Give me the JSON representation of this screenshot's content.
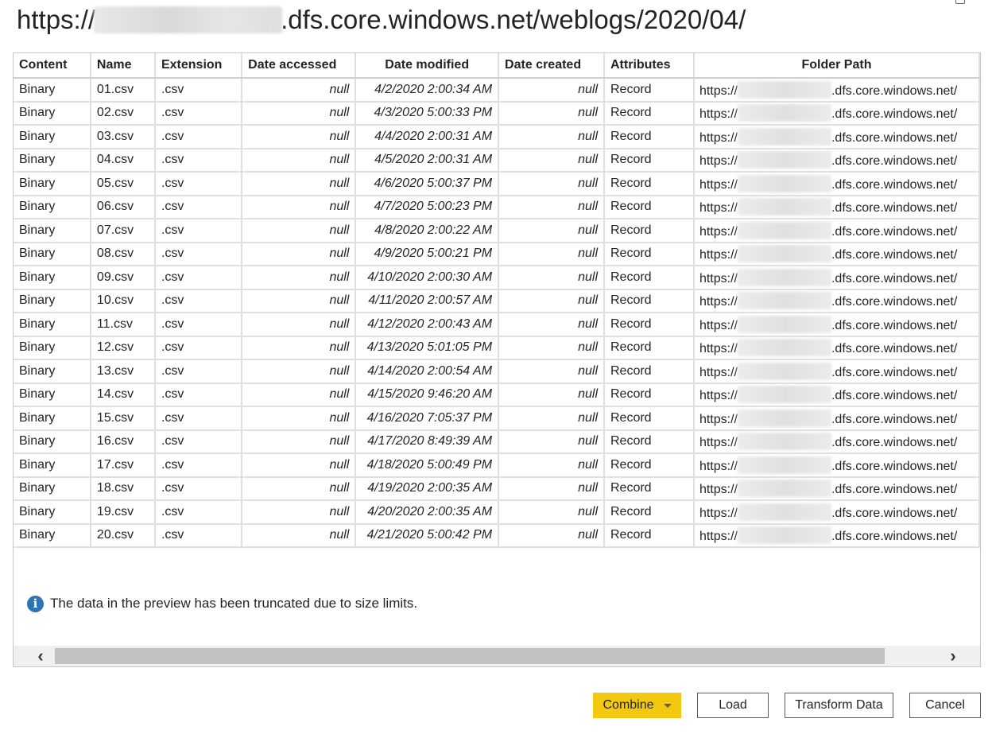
{
  "window": {
    "title_prefix": "https://",
    "title_suffix": ".dfs.core.windows.net/weblogs/2020/04/"
  },
  "table": {
    "columns": [
      "Content",
      "Name",
      "Extension",
      "Date accessed",
      "Date modified",
      "Date created",
      "Attributes",
      "Folder Path"
    ],
    "rows": [
      [
        "Binary",
        "01.csv",
        ".csv",
        "null",
        "4/2/2020 2:00:34 AM",
        "null",
        "Record",
        "https://",
        ".dfs.core.windows.net/"
      ],
      [
        "Binary",
        "02.csv",
        ".csv",
        "null",
        "4/3/2020 5:00:33 PM",
        "null",
        "Record",
        "https://",
        ".dfs.core.windows.net/"
      ],
      [
        "Binary",
        "03.csv",
        ".csv",
        "null",
        "4/4/2020 2:00:31 AM",
        "null",
        "Record",
        "https://",
        ".dfs.core.windows.net/"
      ],
      [
        "Binary",
        "04.csv",
        ".csv",
        "null",
        "4/5/2020 2:00:31 AM",
        "null",
        "Record",
        "https://",
        ".dfs.core.windows.net/"
      ],
      [
        "Binary",
        "05.csv",
        ".csv",
        "null",
        "4/6/2020 5:00:37 PM",
        "null",
        "Record",
        "https://",
        ".dfs.core.windows.net/"
      ],
      [
        "Binary",
        "06.csv",
        ".csv",
        "null",
        "4/7/2020 5:00:23 PM",
        "null",
        "Record",
        "https://",
        ".dfs.core.windows.net/"
      ],
      [
        "Binary",
        "07.csv",
        ".csv",
        "null",
        "4/8/2020 2:00:22 AM",
        "null",
        "Record",
        "https://",
        ".dfs.core.windows.net/"
      ],
      [
        "Binary",
        "08.csv",
        ".csv",
        "null",
        "4/9/2020 5:00:21 PM",
        "null",
        "Record",
        "https://",
        ".dfs.core.windows.net/"
      ],
      [
        "Binary",
        "09.csv",
        ".csv",
        "null",
        "4/10/2020 2:00:30 AM",
        "null",
        "Record",
        "https://",
        ".dfs.core.windows.net/"
      ],
      [
        "Binary",
        "10.csv",
        ".csv",
        "null",
        "4/11/2020 2:00:57 AM",
        "null",
        "Record",
        "https://",
        ".dfs.core.windows.net/"
      ],
      [
        "Binary",
        "11.csv",
        ".csv",
        "null",
        "4/12/2020 2:00:43 AM",
        "null",
        "Record",
        "https://",
        ".dfs.core.windows.net/"
      ],
      [
        "Binary",
        "12.csv",
        ".csv",
        "null",
        "4/13/2020 5:01:05 PM",
        "null",
        "Record",
        "https://",
        ".dfs.core.windows.net/"
      ],
      [
        "Binary",
        "13.csv",
        ".csv",
        "null",
        "4/14/2020 2:00:54 AM",
        "null",
        "Record",
        "https://",
        ".dfs.core.windows.net/"
      ],
      [
        "Binary",
        "14.csv",
        ".csv",
        "null",
        "4/15/2020 9:46:20 AM",
        "null",
        "Record",
        "https://",
        ".dfs.core.windows.net/"
      ],
      [
        "Binary",
        "15.csv",
        ".csv",
        "null",
        "4/16/2020 7:05:37 PM",
        "null",
        "Record",
        "https://",
        ".dfs.core.windows.net/"
      ],
      [
        "Binary",
        "16.csv",
        ".csv",
        "null",
        "4/17/2020 8:49:39 AM",
        "null",
        "Record",
        "https://",
        ".dfs.core.windows.net/"
      ],
      [
        "Binary",
        "17.csv",
        ".csv",
        "null",
        "4/18/2020 5:00:49 PM",
        "null",
        "Record",
        "https://",
        ".dfs.core.windows.net/"
      ],
      [
        "Binary",
        "18.csv",
        ".csv",
        "null",
        "4/19/2020 2:00:35 AM",
        "null",
        "Record",
        "https://",
        ".dfs.core.windows.net/"
      ],
      [
        "Binary",
        "19.csv",
        ".csv",
        "null",
        "4/20/2020 2:00:35 AM",
        "null",
        "Record",
        "https://",
        ".dfs.core.windows.net/"
      ],
      [
        "Binary",
        "20.csv",
        ".csv",
        "null",
        "4/21/2020 5:00:42 PM",
        "null",
        "Record",
        "https://",
        ".dfs.core.windows.net/"
      ]
    ]
  },
  "note": {
    "icon": "info-icon",
    "icon_glyph": "i",
    "text": "The data in the preview has been truncated due to size limits."
  },
  "scrollbar": {
    "left_icon": "chevron-left-icon",
    "right_icon": "chevron-right-icon"
  },
  "buttons": {
    "combine": "Combine",
    "load": "Load",
    "transform": "Transform Data",
    "cancel": "Cancel"
  },
  "colors": {
    "accent": "#f2c811",
    "info": "#2e75b6",
    "grid": "#e1dfdd"
  }
}
